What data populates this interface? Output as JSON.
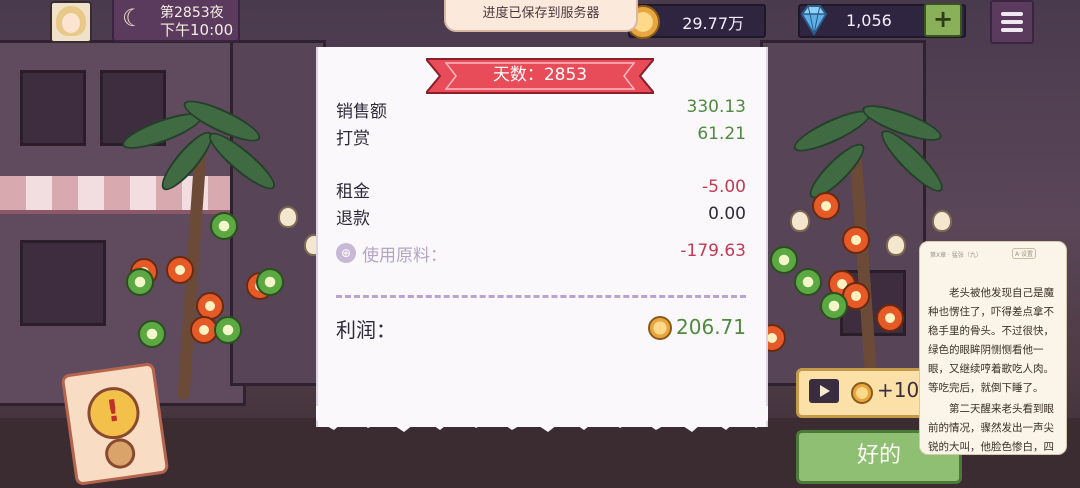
{
  "hud": {
    "night_label": "第2853夜",
    "time_label": "下午10:00",
    "save_toast": "进度已保存到服务器",
    "coins": "29.77万",
    "gems": "1,056",
    "add_label": "+"
  },
  "receipt": {
    "day_banner": "天数：2853",
    "rows": [
      {
        "label": "销售额",
        "value": "330.13"
      },
      {
        "label": "打赏",
        "value": "61.21"
      },
      {
        "label": "租金",
        "value": "-5.00"
      },
      {
        "label": "退款",
        "value": "0.00"
      },
      {
        "label": "使用原料：",
        "value": "-179.63"
      }
    ],
    "profit_label": "利润：",
    "profit_value": "206.71"
  },
  "actions": {
    "ad_bonus": "+10",
    "ok_label": "好的"
  },
  "reader": {
    "header": "第X章 · 猛张（九）",
    "chip": "A·设置",
    "para1": "老头被他发现自己是魔种也愣住了，吓得差点拿不稳手里的骨头。不过很快，绿色的眼眸阴恻恻看他一眼，又继续哼着歌吃人肉。等吃完后，就倒下睡了。",
    "para2": "第二天醒来老头看到眼前的情况，骤然发出一声尖锐的大叫，他脸色惨白，四肢颤"
  },
  "colors": {
    "positive": "#4f8a3e",
    "negative": "#c23a53",
    "ribbon": "#e84c58",
    "ok_button": "#8fbf72"
  }
}
